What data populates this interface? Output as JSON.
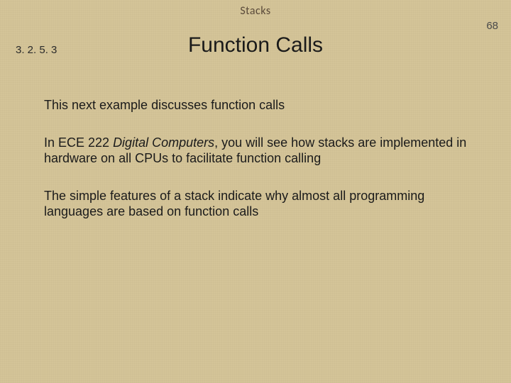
{
  "header": {
    "topic": "Stacks",
    "page_number": "68"
  },
  "section_number": "3. 2. 5. 3",
  "title": "Function Calls",
  "paragraphs": {
    "p1": "This next example discusses function calls",
    "p2_pre": "In ECE 222 ",
    "p2_italic": "Digital Computers",
    "p2_post": ", you will see how stacks are implemented in hardware on all CPUs to facilitate function calling",
    "p3": "The simple features of a stack indicate why almost all programming languages are based on function calls"
  }
}
